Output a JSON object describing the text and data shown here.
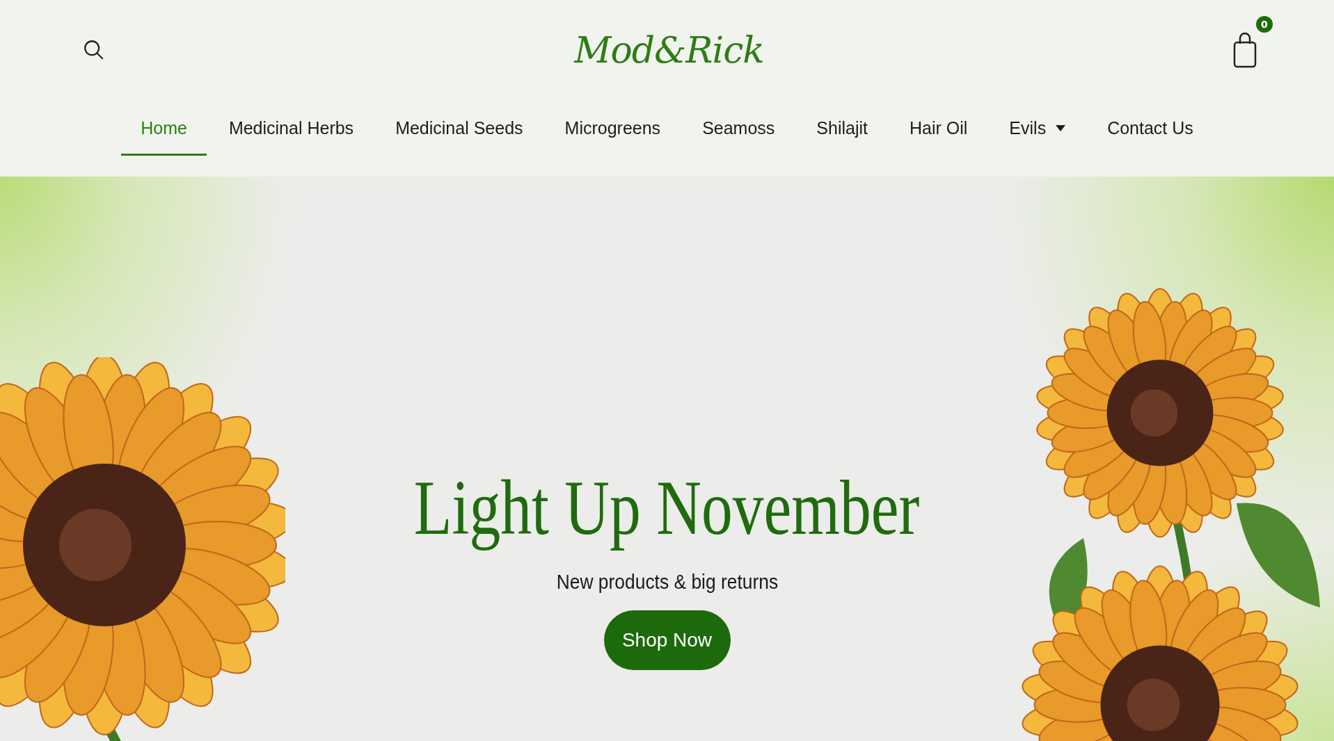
{
  "header": {
    "logo": "Mod&Rick",
    "cart_count": "0"
  },
  "nav": [
    {
      "label": "Home",
      "selected": true,
      "has_dropdown": false
    },
    {
      "label": "Medicinal Herbs",
      "selected": false,
      "has_dropdown": false
    },
    {
      "label": "Medicinal Seeds",
      "selected": false,
      "has_dropdown": false
    },
    {
      "label": "Microgreens",
      "selected": false,
      "has_dropdown": false
    },
    {
      "label": "Seamoss",
      "selected": false,
      "has_dropdown": false
    },
    {
      "label": "Shilajit",
      "selected": false,
      "has_dropdown": false
    },
    {
      "label": "Hair Oil",
      "selected": false,
      "has_dropdown": false
    },
    {
      "label": "Evils",
      "selected": false,
      "has_dropdown": true
    },
    {
      "label": "Contact Us",
      "selected": false,
      "has_dropdown": false
    }
  ],
  "hero": {
    "title": "Light Up November",
    "subtitle": "New products & big returns",
    "button": "Shop Now"
  }
}
